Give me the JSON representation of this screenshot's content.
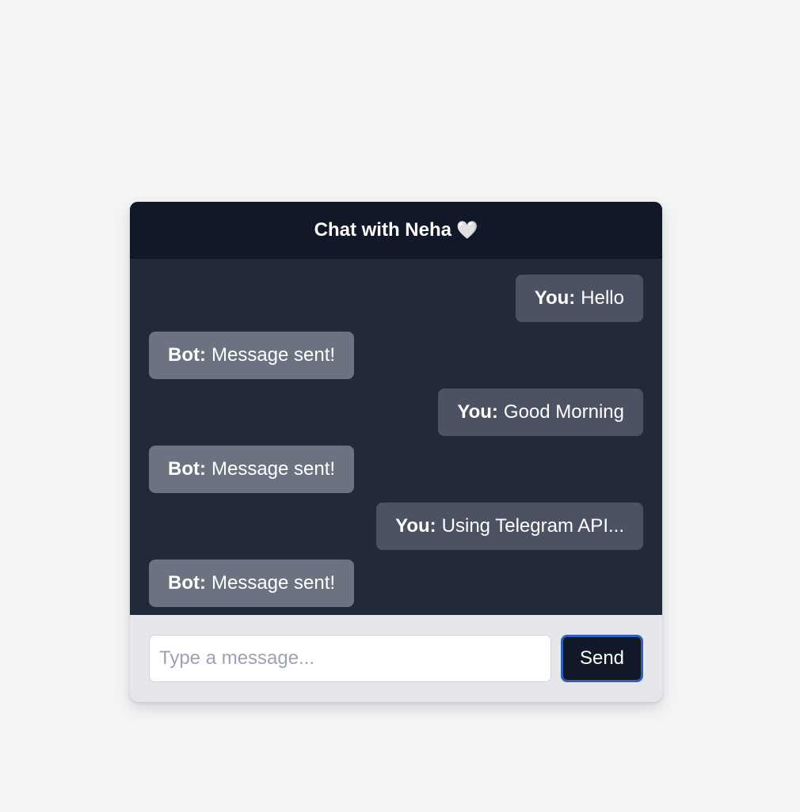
{
  "header": {
    "title": "Chat with Neha",
    "icon": "white-heart-icon",
    "icon_glyph": "🤍"
  },
  "messages": [
    {
      "sender": "You",
      "sender_label": "You:",
      "text": "Hello"
    },
    {
      "sender": "Bot",
      "sender_label": "Bot:",
      "text": "Message sent!"
    },
    {
      "sender": "You",
      "sender_label": "You:",
      "text": "Good Morning"
    },
    {
      "sender": "Bot",
      "sender_label": "Bot:",
      "text": "Message sent!"
    },
    {
      "sender": "You",
      "sender_label": "You:",
      "text": "Using Telegram API..."
    },
    {
      "sender": "Bot",
      "sender_label": "Bot:",
      "text": "Message sent!"
    }
  ],
  "composer": {
    "placeholder": "Type a message...",
    "value": "",
    "send_label": "Send"
  },
  "colors": {
    "page_background": "#f3f4f6",
    "header_background": "#111827",
    "messages_background": "#222938",
    "user_bubble": "#4b5261",
    "bot_bubble": "#6b7280",
    "composer_background": "#e5e7eb",
    "send_button": "#111827",
    "send_button_focus_ring": "#2f5fb8"
  }
}
